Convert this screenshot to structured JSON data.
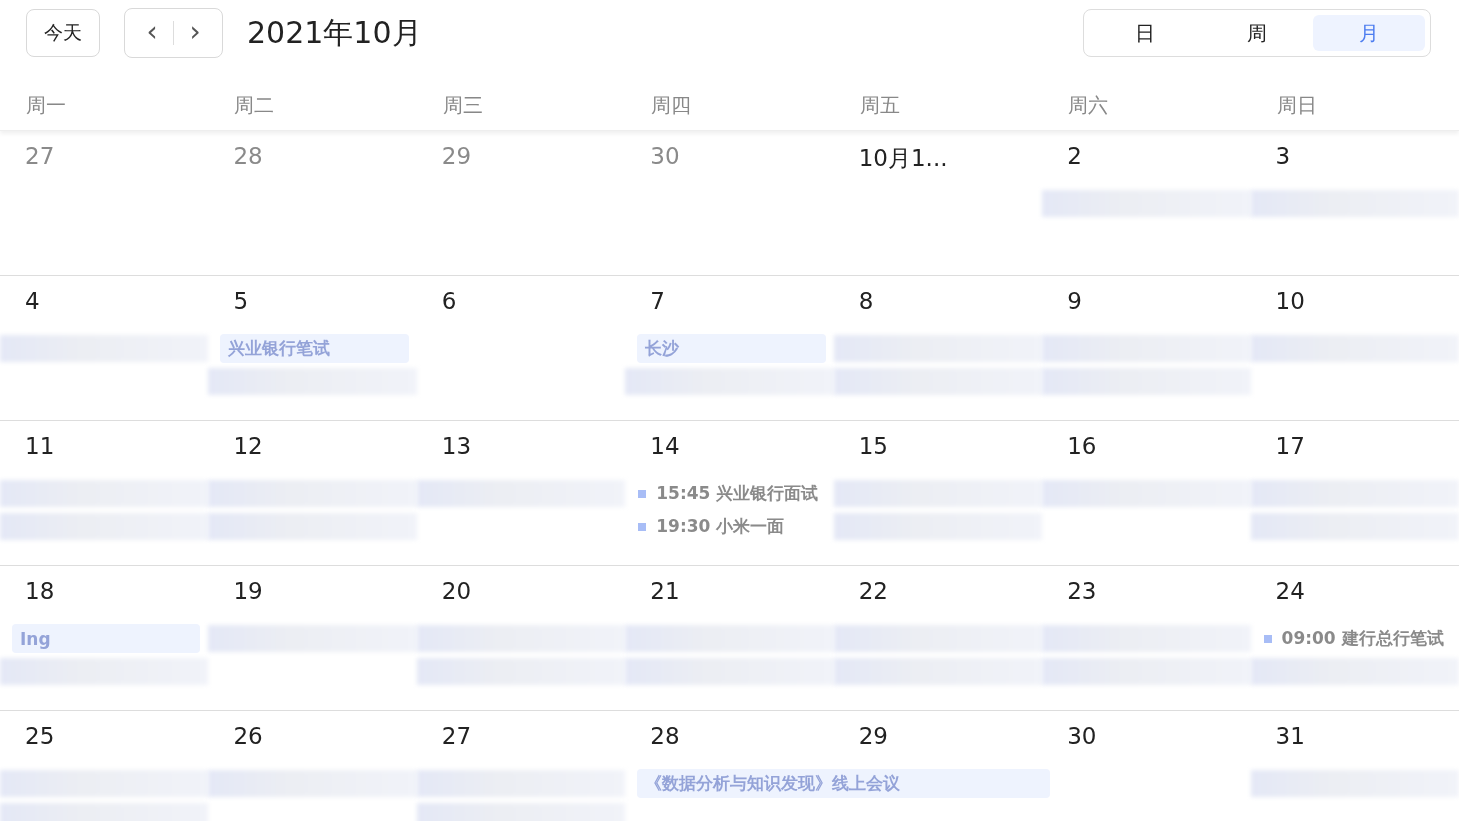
{
  "toolbar": {
    "today_button": "今天",
    "prev_icon": "‹",
    "next_icon": "›",
    "title": "2021年10月"
  },
  "views": [
    {
      "label": "日",
      "selected": false
    },
    {
      "label": "周",
      "selected": false
    },
    {
      "label": "月",
      "selected": true
    }
  ],
  "weekdays": [
    "周一",
    "周二",
    "周三",
    "周四",
    "周五",
    "周六",
    "周日"
  ],
  "weeks": [
    {
      "days": [
        {
          "label": "27",
          "other_month": true
        },
        {
          "label": "28",
          "other_month": true
        },
        {
          "label": "29",
          "other_month": true
        },
        {
          "label": "30",
          "other_month": true
        },
        {
          "label": "10月1...",
          "other_month": false
        },
        {
          "label": "2",
          "other_month": false,
          "events": [
            {
              "kind": "blurred"
            }
          ]
        },
        {
          "label": "3",
          "other_month": false,
          "events": [
            {
              "kind": "blurred"
            }
          ]
        }
      ]
    },
    {
      "days": [
        {
          "label": "4",
          "other_month": false,
          "events": [
            {
              "kind": "blurred"
            }
          ]
        },
        {
          "label": "5",
          "other_month": false,
          "events": [
            {
              "kind": "bar",
              "title": "兴业银行笔试"
            },
            {
              "kind": "blurred"
            }
          ]
        },
        {
          "label": "6",
          "other_month": false
        },
        {
          "label": "7",
          "other_month": false,
          "events": [
            {
              "kind": "bar",
              "title": "长沙"
            },
            {
              "kind": "blurred"
            }
          ]
        },
        {
          "label": "8",
          "other_month": false,
          "events": [
            {
              "kind": "blurred"
            },
            {
              "kind": "blurred"
            }
          ]
        },
        {
          "label": "9",
          "other_month": false,
          "events": [
            {
              "kind": "blurred"
            },
            {
              "kind": "blurred"
            }
          ]
        },
        {
          "label": "10",
          "other_month": false,
          "events": [
            {
              "kind": "blurred"
            }
          ]
        }
      ]
    },
    {
      "days": [
        {
          "label": "11",
          "other_month": false,
          "events": [
            {
              "kind": "blurred"
            },
            {
              "kind": "blurred"
            }
          ]
        },
        {
          "label": "12",
          "other_month": false,
          "events": [
            {
              "kind": "blurred"
            },
            {
              "kind": "blurred"
            }
          ]
        },
        {
          "label": "13",
          "other_month": false,
          "events": [
            {
              "kind": "blurred"
            }
          ]
        },
        {
          "label": "14",
          "other_month": false,
          "events": [
            {
              "kind": "dot",
              "time": "15:45",
              "title": "兴业银行面试"
            },
            {
              "kind": "dot",
              "time": "19:30",
              "title": "小米一面"
            }
          ]
        },
        {
          "label": "15",
          "other_month": false,
          "events": [
            {
              "kind": "blurred"
            },
            {
              "kind": "blurred"
            }
          ]
        },
        {
          "label": "16",
          "other_month": false,
          "events": [
            {
              "kind": "blurred"
            }
          ]
        },
        {
          "label": "17",
          "other_month": false,
          "events": [
            {
              "kind": "blurred"
            },
            {
              "kind": "blurred"
            }
          ]
        }
      ]
    },
    {
      "days": [
        {
          "label": "18",
          "other_month": false,
          "events": [
            {
              "kind": "bar",
              "title": "Ing"
            },
            {
              "kind": "blurred"
            }
          ]
        },
        {
          "label": "19",
          "other_month": false,
          "events": [
            {
              "kind": "blurred"
            }
          ]
        },
        {
          "label": "20",
          "other_month": false,
          "events": [
            {
              "kind": "blurred"
            },
            {
              "kind": "blurred"
            }
          ]
        },
        {
          "label": "21",
          "other_month": false,
          "events": [
            {
              "kind": "blurred"
            },
            {
              "kind": "blurred"
            }
          ]
        },
        {
          "label": "22",
          "other_month": false,
          "events": [
            {
              "kind": "blurred"
            },
            {
              "kind": "blurred"
            }
          ]
        },
        {
          "label": "23",
          "other_month": false,
          "events": [
            {
              "kind": "blurred"
            },
            {
              "kind": "blurred"
            }
          ]
        },
        {
          "label": "24",
          "other_month": false,
          "events": [
            {
              "kind": "dot",
              "time": "09:00",
              "title": "建行总行笔试"
            },
            {
              "kind": "blurred"
            }
          ]
        }
      ]
    },
    {
      "days": [
        {
          "label": "25",
          "other_month": false,
          "events": [
            {
              "kind": "blurred"
            },
            {
              "kind": "blurred"
            }
          ]
        },
        {
          "label": "26",
          "other_month": false,
          "events": [
            {
              "kind": "blurred"
            }
          ]
        },
        {
          "label": "27",
          "other_month": false,
          "events": [
            {
              "kind": "blurred"
            },
            {
              "kind": "blurred"
            }
          ]
        },
        {
          "label": "28",
          "other_month": false,
          "events": [
            {
              "kind": "wide_bar",
              "title": "《数据分析与知识发现》线上会议"
            }
          ]
        },
        {
          "label": "29",
          "other_month": false
        },
        {
          "label": "30",
          "other_month": false
        },
        {
          "label": "31",
          "other_month": false,
          "events": [
            {
              "kind": "blurred"
            }
          ]
        }
      ]
    }
  ]
}
